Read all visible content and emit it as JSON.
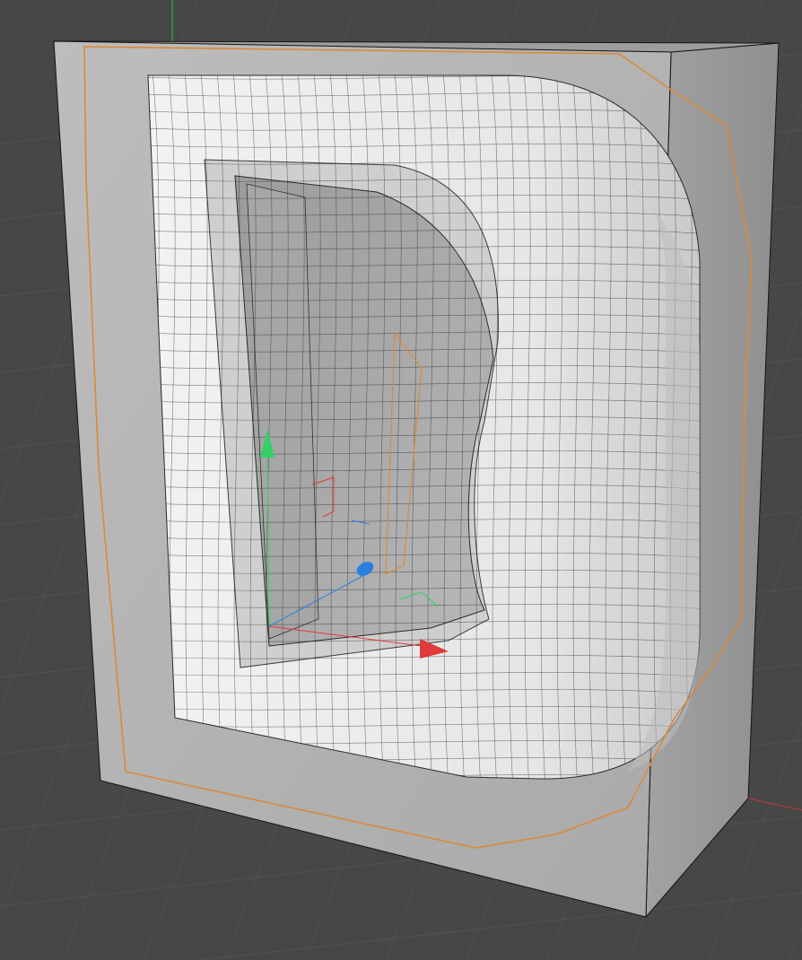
{
  "viewport": {
    "background_color": "#474747",
    "grid_color": "#5a5a5a",
    "projection": "perspective"
  },
  "scene": {
    "object": {
      "shape": "letter-D",
      "display_mode": "shaded-wireframe",
      "surface_color": "#e8e8e8",
      "wire_color": "#1e1e1e",
      "selected": true,
      "selection_outline_color": "#d98a3a"
    },
    "bounding_cage": {
      "face_color": "#b5b5b5",
      "side_color": "#a0a0a0",
      "edge_color": "#141414"
    },
    "gizmo": {
      "axes": [
        {
          "axis": "x",
          "color": "#e03a3a",
          "icon": "arrow-cone"
        },
        {
          "axis": "y",
          "color": "#34d06a",
          "icon": "arrow-cone"
        },
        {
          "axis": "z",
          "color": "#2a7fe0",
          "icon": "arrow-cone"
        }
      ]
    },
    "world_axes": {
      "x_color": "#c23a3a",
      "y_color": "#2fbf5a"
    }
  }
}
